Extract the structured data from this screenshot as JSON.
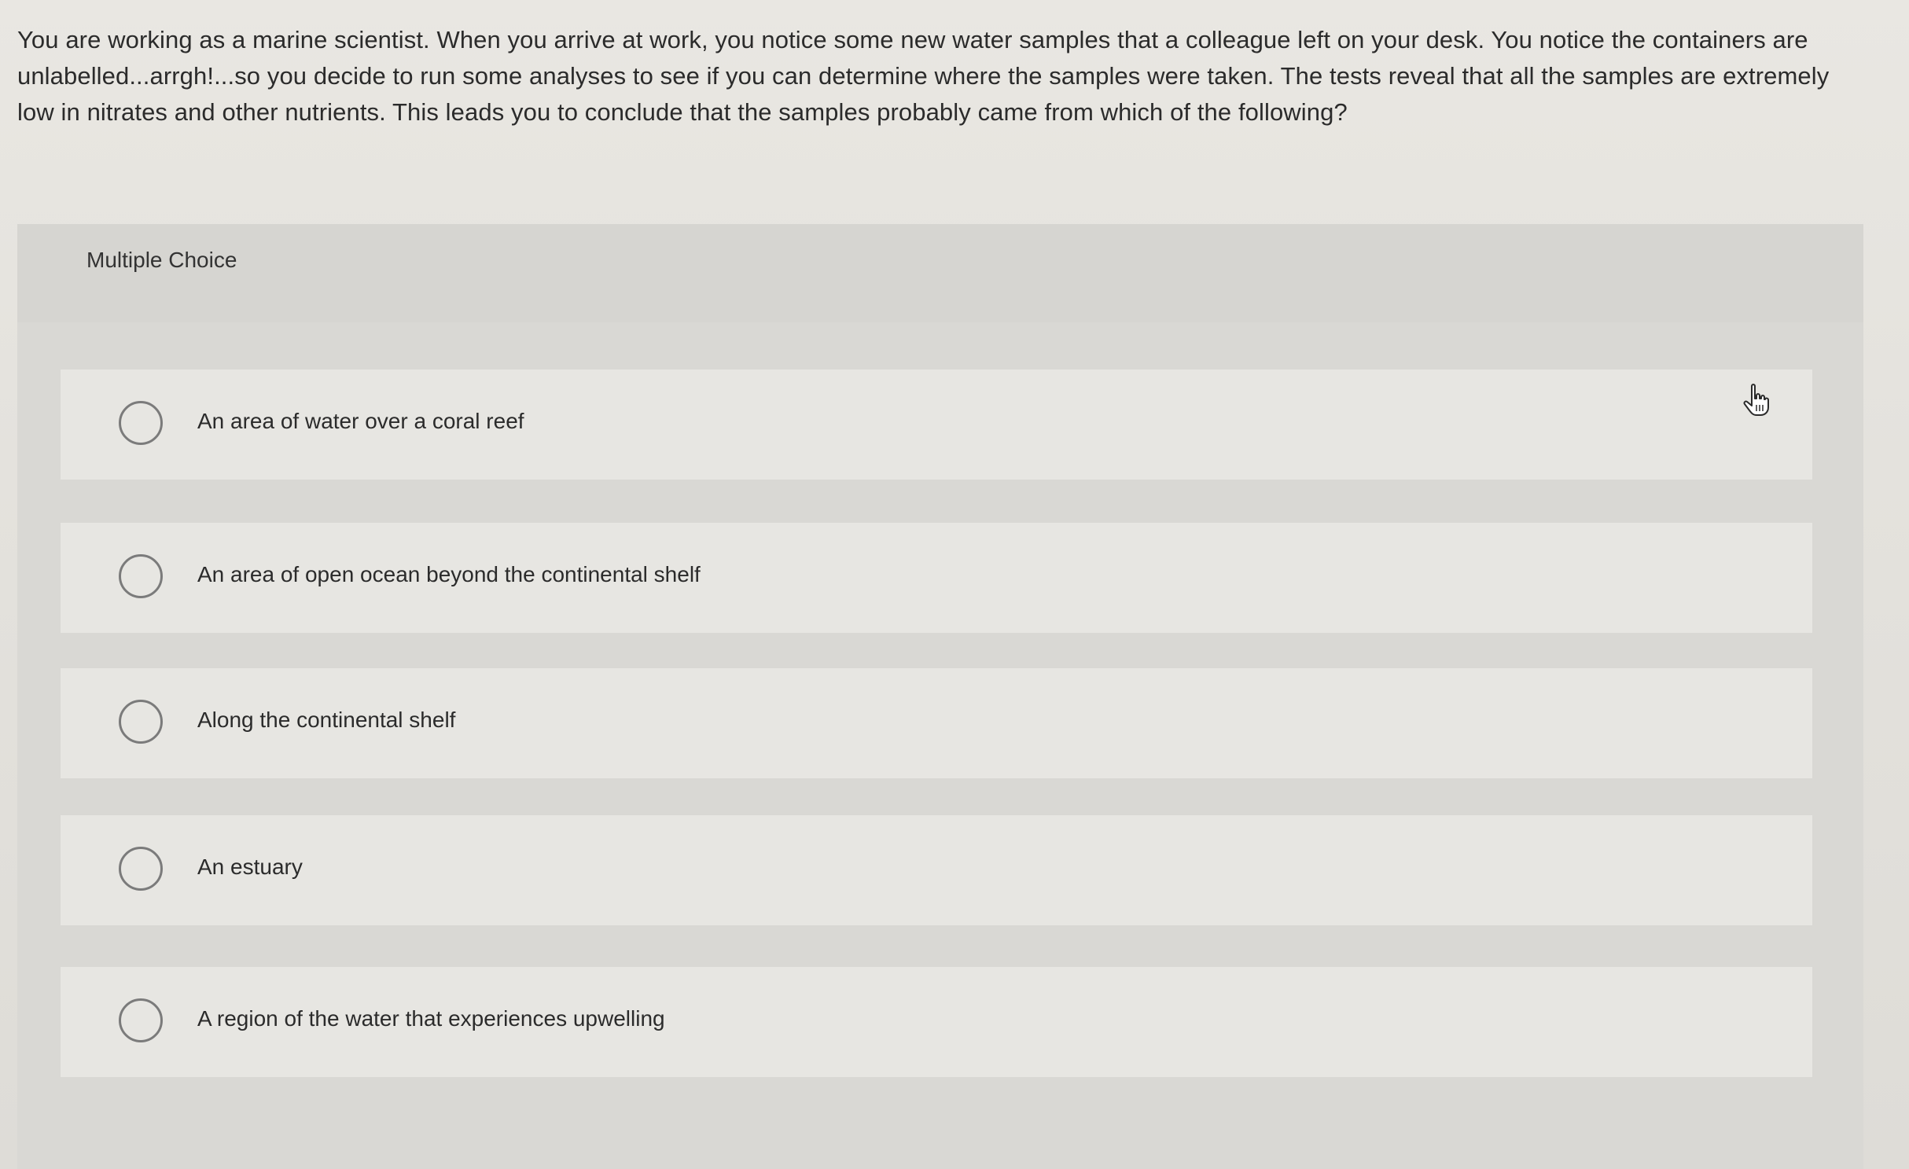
{
  "question": {
    "text": "You are working as a marine scientist. When you arrive at work, you notice some new water samples that a colleague left on your desk. You notice the containers are unlabelled...arrgh!...so you decide to run some analyses to see if you can determine where the samples were taken. The tests reveal that all the samples are extremely low in nitrates and other nutrients. This leads you to conclude that the samples probably came from which of the following?"
  },
  "multiple_choice": {
    "label": "Multiple Choice",
    "options": [
      {
        "label": "An area of water over a coral reef"
      },
      {
        "label": "An area of open ocean beyond the continental shelf"
      },
      {
        "label": "Along the continental shelf"
      },
      {
        "label": "An estuary"
      },
      {
        "label": "A region of the water that experiences upwelling"
      }
    ]
  },
  "icons": {
    "radio": "radio-unchecked-icon",
    "cursor": "hand-pointer-icon"
  }
}
